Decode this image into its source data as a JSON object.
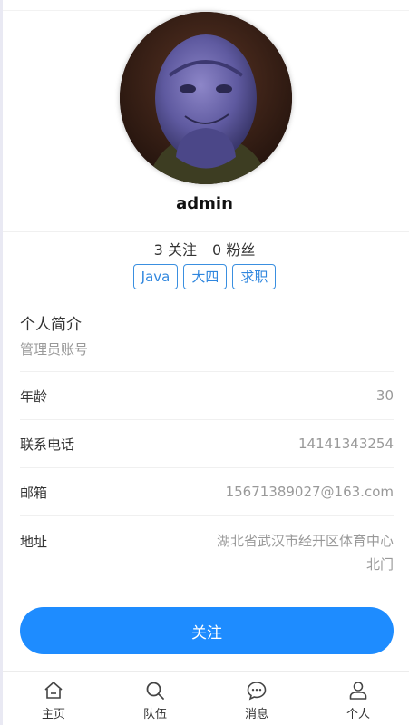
{
  "profile": {
    "username": "admin",
    "following_count": "3",
    "following_label": "关注",
    "followers_count": "0",
    "followers_label": "粉丝",
    "tags": [
      "Java",
      "大四",
      "求职"
    ]
  },
  "intro": {
    "title": "个人简介",
    "text": "管理员账号"
  },
  "details": {
    "age_label": "年龄",
    "age_value": "30",
    "phone_label": "联系电话",
    "phone_value": "14141343254",
    "email_label": "邮箱",
    "email_value": "15671389027@163.com",
    "address_label": "地址",
    "address_value": "湖北省武汉市经开区体育中心北门"
  },
  "actions": {
    "follow_label": "关注"
  },
  "tabbar": {
    "items": [
      {
        "label": "主页",
        "icon": "home-icon"
      },
      {
        "label": "队伍",
        "icon": "search-icon"
      },
      {
        "label": "消息",
        "icon": "message-icon"
      },
      {
        "label": "个人",
        "icon": "user-icon"
      }
    ]
  },
  "colors": {
    "accent": "#1e8cff",
    "tag_border": "#3a8fe0",
    "muted_text": "#999999"
  }
}
